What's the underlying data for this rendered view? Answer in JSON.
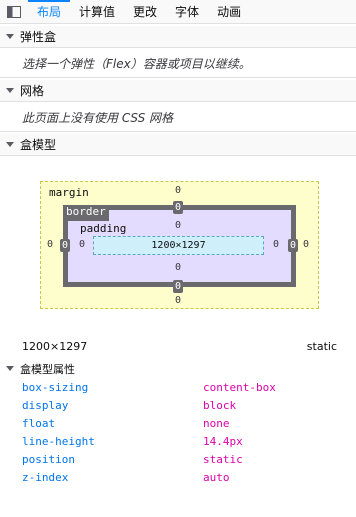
{
  "tabs": [
    {
      "label": "布局",
      "active": true
    },
    {
      "label": "计算值",
      "active": false
    },
    {
      "label": "更改",
      "active": false
    },
    {
      "label": "字体",
      "active": false
    },
    {
      "label": "动画",
      "active": false
    }
  ],
  "flex_section": {
    "title": "弹性盒",
    "message": "选择一个弹性（Flex）容器或项目以继续。"
  },
  "grid_section": {
    "title": "网格",
    "message": "此页面上没有使用 CSS 网格"
  },
  "boxmodel_section": {
    "title": "盒模型",
    "margin_label": "margin",
    "border_label": "border",
    "padding_label": "padding",
    "content_size": "1200×1297",
    "margin": {
      "top": "0",
      "right": "0",
      "bottom": "0",
      "left": "0"
    },
    "border": {
      "top": "0",
      "right": "0",
      "bottom": "0",
      "left": "0"
    },
    "padding": {
      "top": "0",
      "right": "0",
      "bottom": "0",
      "left": "0"
    },
    "dimensions": "1200×1297",
    "position": "static"
  },
  "properties_section": {
    "title": "盒模型属性",
    "rows": [
      {
        "name": "box-sizing",
        "value": "content-box"
      },
      {
        "name": "display",
        "value": "block"
      },
      {
        "name": "float",
        "value": "none"
      },
      {
        "name": "line-height",
        "value": "14.4px"
      },
      {
        "name": "position",
        "value": "static"
      },
      {
        "name": "z-index",
        "value": "auto"
      }
    ]
  },
  "colors": {
    "accent": "#0a84ff",
    "prop_name": "#0074e8",
    "prop_value": "#dd00a9",
    "margin_bg": "#fefecc",
    "border_bg": "#e3dcff",
    "padding_bg": "#cff0fb"
  },
  "icons": {
    "sidebar_toggle": "sidebar-toggle-icon",
    "twisty": "chevron-down-icon"
  }
}
